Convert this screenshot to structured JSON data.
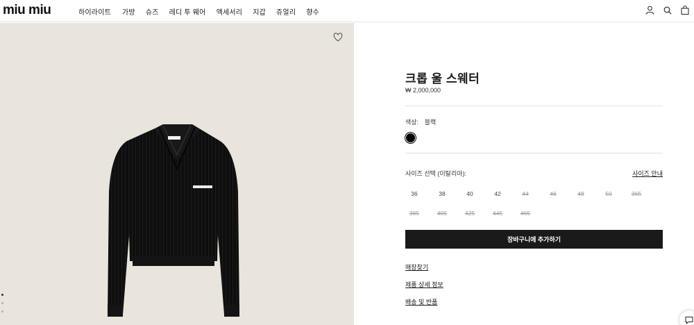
{
  "header": {
    "logo_text": "miu miu",
    "nav": [
      "하이라이트",
      "가방",
      "슈즈",
      "레디 투 웨어",
      "액세서리",
      "지갑",
      "쥬얼리",
      "향수"
    ],
    "icons": [
      "user-icon",
      "search-icon",
      "bag-icon"
    ]
  },
  "gallery": {
    "icons": [
      "heart-icon"
    ],
    "dots_count": 3,
    "active_dot": 0,
    "background_color": "#e9e4dc"
  },
  "product": {
    "title": "크롭 울 스웨터",
    "price": "₩ 2,000,000",
    "color_label": "색상:",
    "color_value": "블랙",
    "swatch_color": "#000000",
    "size_label": "사이즈 선택 (이탈리아):",
    "size_guide": "사이즈 안내",
    "sizes_row1": [
      {
        "label": "36",
        "available": true
      },
      {
        "label": "38",
        "available": true
      },
      {
        "label": "40",
        "available": true
      },
      {
        "label": "42",
        "available": true
      },
      {
        "label": "44",
        "available": false
      },
      {
        "label": "46",
        "available": false
      },
      {
        "label": "48",
        "available": false
      },
      {
        "label": "50",
        "available": false
      },
      {
        "label": "365",
        "available": false
      }
    ],
    "sizes_row2": [
      {
        "label": "385",
        "available": false
      },
      {
        "label": "405",
        "available": false
      },
      {
        "label": "425",
        "available": false
      },
      {
        "label": "445",
        "available": false
      },
      {
        "label": "465",
        "available": false
      }
    ],
    "add_to_cart": "장바구니에 추가하기",
    "links": [
      "매장찾기",
      "제품 상세 정보",
      "배송 및 반품"
    ]
  },
  "chat": {
    "icon": "chat-icon"
  }
}
